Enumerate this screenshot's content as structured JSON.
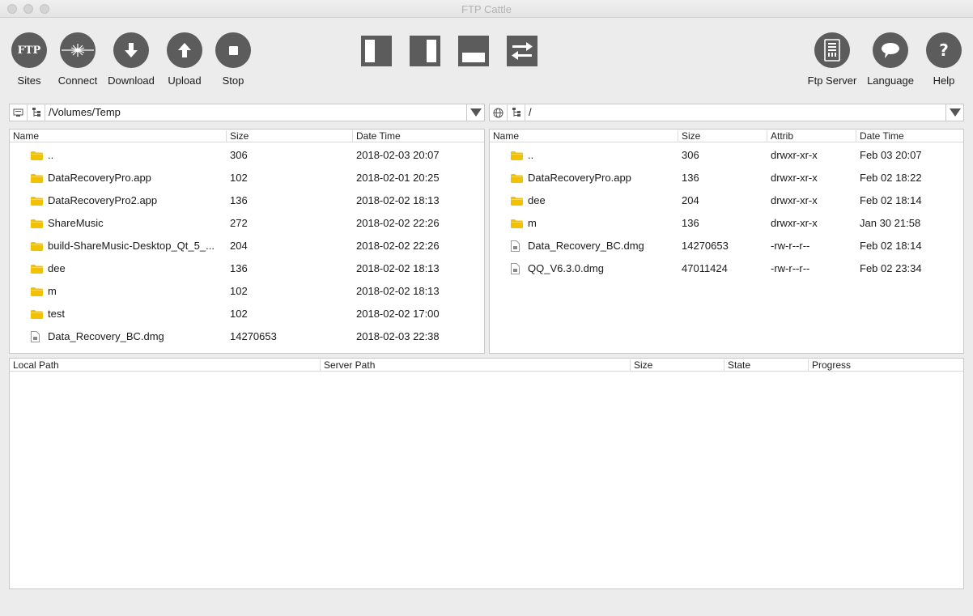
{
  "window": {
    "title": "FTP Cattle"
  },
  "toolbar": {
    "sites": "Sites",
    "connect": "Connect",
    "download": "Download",
    "upload": "Upload",
    "stop": "Stop",
    "ftp_server": "Ftp Server",
    "language": "Language",
    "help": "Help",
    "sites_icon_text": "FTP"
  },
  "local": {
    "path": "/Volumes/Temp",
    "columns": {
      "name": "Name",
      "size": "Size",
      "date": "Date Time"
    },
    "rows": [
      {
        "name": "..",
        "size": "306",
        "date": "2018-02-03 20:07",
        "type": "folder"
      },
      {
        "name": "DataRecoveryPro.app",
        "size": "102",
        "date": "2018-02-01 20:25",
        "type": "folder"
      },
      {
        "name": "DataRecoveryPro2.app",
        "size": "136",
        "date": "2018-02-02 18:13",
        "type": "folder"
      },
      {
        "name": "ShareMusic",
        "size": "272",
        "date": "2018-02-02 22:26",
        "type": "folder"
      },
      {
        "name": "build-ShareMusic-Desktop_Qt_5_...",
        "size": "204",
        "date": "2018-02-02 22:26",
        "type": "folder"
      },
      {
        "name": "dee",
        "size": "136",
        "date": "2018-02-02 18:13",
        "type": "folder"
      },
      {
        "name": "m",
        "size": "102",
        "date": "2018-02-02 18:13",
        "type": "folder"
      },
      {
        "name": "test",
        "size": "102",
        "date": "2018-02-02 17:00",
        "type": "folder"
      },
      {
        "name": "Data_Recovery_BC.dmg",
        "size": "14270653",
        "date": "2018-02-03 22:38",
        "type": "file"
      }
    ]
  },
  "remote": {
    "path": "/",
    "columns": {
      "name": "Name",
      "size": "Size",
      "attrib": "Attrib",
      "date": "Date Time"
    },
    "rows": [
      {
        "name": "..",
        "size": "306",
        "attrib": "drwxr-xr-x",
        "date": "Feb 03 20:07",
        "type": "folder"
      },
      {
        "name": "DataRecoveryPro.app",
        "size": "136",
        "attrib": "drwxr-xr-x",
        "date": "Feb 02 18:22",
        "type": "folder"
      },
      {
        "name": "dee",
        "size": "204",
        "attrib": "drwxr-xr-x",
        "date": "Feb 02 18:14",
        "type": "folder"
      },
      {
        "name": "m",
        "size": "136",
        "attrib": "drwxr-xr-x",
        "date": "Jan 30 21:58",
        "type": "folder"
      },
      {
        "name": "Data_Recovery_BC.dmg",
        "size": "14270653",
        "attrib": "-rw-r--r--",
        "date": "Feb 02 18:14",
        "type": "file"
      },
      {
        "name": "QQ_V6.3.0.dmg",
        "size": "47011424",
        "attrib": "-rw-r--r--",
        "date": "Feb 02 23:34",
        "type": "file"
      }
    ]
  },
  "transfers": {
    "columns": {
      "local_path": "Local Path",
      "server_path": "Server Path",
      "size": "Size",
      "state": "State",
      "progress": "Progress"
    }
  },
  "colors": {
    "folder": "#f2c200",
    "toolbar_icon": "#5c5c5c"
  }
}
